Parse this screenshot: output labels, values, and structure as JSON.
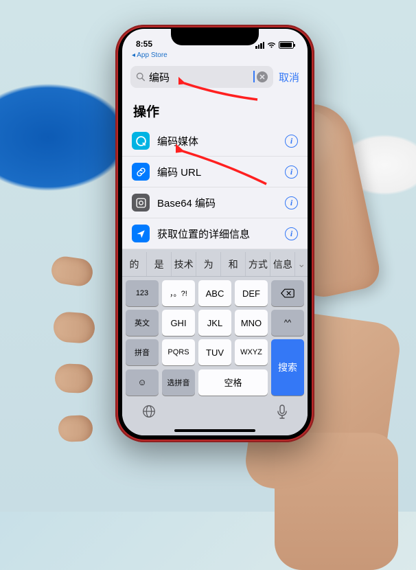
{
  "status": {
    "time": "8:55",
    "back_app": "◂ App Store"
  },
  "search": {
    "query": "编码",
    "cancel": "取消"
  },
  "section": {
    "title": "操作"
  },
  "rows": [
    {
      "icon": "quicktime",
      "label": "编码媒体"
    },
    {
      "icon": "link",
      "label": "编码 URL"
    },
    {
      "icon": "b64",
      "label": "Base64 编码"
    },
    {
      "icon": "location",
      "label": "获取位置的详细信息"
    }
  ],
  "candidates": [
    "的",
    "是",
    "技术",
    "为",
    "和",
    "方式",
    "信息",
    "⌄"
  ],
  "keys": {
    "r1": [
      "123",
      "，。?!",
      "ABC",
      "DEF"
    ],
    "del": "⌫",
    "r2": [
      "英文",
      "GHI",
      "JKL",
      "MNO"
    ],
    "face": "^^",
    "r3": [
      "拼音",
      "PQRS",
      "TUV",
      "WXYZ"
    ],
    "search": "搜索",
    "r4": [
      "☺",
      "选拼音",
      "空格"
    ]
  }
}
